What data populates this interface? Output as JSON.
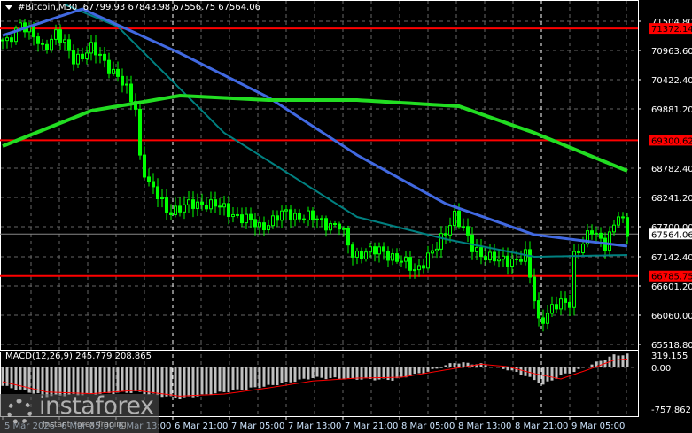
{
  "header": {
    "symbol": "#Bitcoin,M30",
    "ohlc": "67799.93 67843.98 67556.75 67564.06"
  },
  "macd": {
    "label": "MACD(12,26,9) 245.779 208.865",
    "axis": [
      "319.155",
      "0.00",
      "-757.862"
    ]
  },
  "watermark": {
    "brand": "instaforex",
    "tagline": "Instant Forex Trading"
  },
  "colors": {
    "candle": "#00ff00",
    "ma_slow": "#22dd22",
    "ma_mid": "#4169e1",
    "ma_fast": "#008080",
    "level": "#ff0000",
    "macd_hist": "#c0c0c0",
    "macd_signal": "#ff0000"
  },
  "chart_data": {
    "type": "candlestick",
    "title": "#Bitcoin,M30",
    "price_axis": [
      "71504.80",
      "70963.60",
      "70422.40",
      "69881.20",
      "68782.40",
      "68241.20",
      "67700.00",
      "67142.40",
      "66601.20",
      "66060.00",
      "65518.80"
    ],
    "price_axis_values": [
      71504.8,
      70963.6,
      70422.4,
      69881.2,
      68782.4,
      68241.2,
      67700.0,
      67142.4,
      66601.2,
      66060.0,
      65518.8
    ],
    "ylim": [
      65400,
      72000
    ],
    "levels": [
      {
        "label": "71372.14",
        "value": 71372.14
      },
      {
        "label": "69300.62",
        "value": 69300.62
      },
      {
        "label": "66785.75",
        "value": 66785.75
      }
    ],
    "current_price": {
      "label": "67564.06",
      "value": 67564.06
    },
    "time_labels": [
      "5 Mar 2026",
      "6 Mar 05:00",
      "6 Mar 13:00",
      "6 Mar 21:00",
      "7 Mar 05:00",
      "7 Mar 13:00",
      "7 Mar 21:00",
      "8 Mar 05:00",
      "8 Mar 13:00",
      "8 Mar 21:00",
      "9 Mar 05:00"
    ],
    "bars_total": 141,
    "close_keypoints": [
      [
        1,
        71100
      ],
      [
        4,
        71500
      ],
      [
        9,
        71000
      ],
      [
        12,
        71300
      ],
      [
        16,
        70800
      ],
      [
        20,
        71000
      ],
      [
        26,
        70500
      ],
      [
        30,
        69900
      ],
      [
        31,
        69000
      ],
      [
        33,
        68500
      ],
      [
        37,
        68000
      ],
      [
        46,
        68150
      ],
      [
        52,
        67950
      ],
      [
        58,
        67700
      ],
      [
        64,
        67950
      ],
      [
        70,
        67850
      ],
      [
        76,
        67700
      ],
      [
        79,
        67200
      ],
      [
        86,
        67250
      ],
      [
        93,
        66900
      ],
      [
        98,
        67300
      ],
      [
        102,
        67950
      ],
      [
        106,
        67300
      ],
      [
        112,
        67050
      ],
      [
        118,
        67150
      ],
      [
        121,
        65950
      ],
      [
        124,
        66200
      ],
      [
        128,
        66300
      ],
      [
        129,
        67200
      ],
      [
        133,
        67600
      ],
      [
        136,
        67400
      ],
      [
        139,
        67900
      ],
      [
        141,
        67564
      ]
    ],
    "ma_slow_keypoints": [
      [
        0,
        69192
      ],
      [
        20,
        69848
      ],
      [
        40,
        70127
      ],
      [
        60,
        70045
      ],
      [
        80,
        70045
      ],
      [
        103,
        69930
      ],
      [
        120,
        69438
      ],
      [
        141,
        68733
      ]
    ],
    "ma_mid_keypoints": [
      [
        0,
        71242
      ],
      [
        18,
        71734
      ],
      [
        40,
        70914
      ],
      [
        60,
        70094
      ],
      [
        80,
        69028
      ],
      [
        100,
        68126
      ],
      [
        120,
        67552
      ],
      [
        141,
        67339
      ]
    ],
    "ma_fast_keypoints": [
      [
        14,
        71816
      ],
      [
        26,
        71406
      ],
      [
        50,
        69438
      ],
      [
        80,
        67880
      ],
      [
        100,
        67470
      ],
      [
        120,
        67142
      ],
      [
        141,
        67175
      ]
    ],
    "macd_hist_keypoints": [
      [
        0,
        -450
      ],
      [
        10,
        -700
      ],
      [
        20,
        -650
      ],
      [
        30,
        -600
      ],
      [
        40,
        -757
      ],
      [
        50,
        -600
      ],
      [
        60,
        -450
      ],
      [
        70,
        -250
      ],
      [
        80,
        -280
      ],
      [
        88,
        -300
      ],
      [
        96,
        -100
      ],
      [
        102,
        120
      ],
      [
        108,
        80
      ],
      [
        114,
        -50
      ],
      [
        118,
        -200
      ],
      [
        122,
        -420
      ],
      [
        126,
        -200
      ],
      [
        130,
        -60
      ],
      [
        134,
        120
      ],
      [
        138,
        300
      ],
      [
        141,
        320
      ]
    ],
    "macd_signal_keypoints": [
      [
        0,
        -350
      ],
      [
        10,
        -600
      ],
      [
        20,
        -640
      ],
      [
        30,
        -560
      ],
      [
        40,
        -700
      ],
      [
        50,
        -650
      ],
      [
        60,
        -500
      ],
      [
        70,
        -330
      ],
      [
        80,
        -260
      ],
      [
        90,
        -240
      ],
      [
        100,
        -60
      ],
      [
        108,
        80
      ],
      [
        114,
        20
      ],
      [
        120,
        -150
      ],
      [
        126,
        -280
      ],
      [
        132,
        -60
      ],
      [
        138,
        180
      ],
      [
        141,
        208
      ]
    ]
  }
}
